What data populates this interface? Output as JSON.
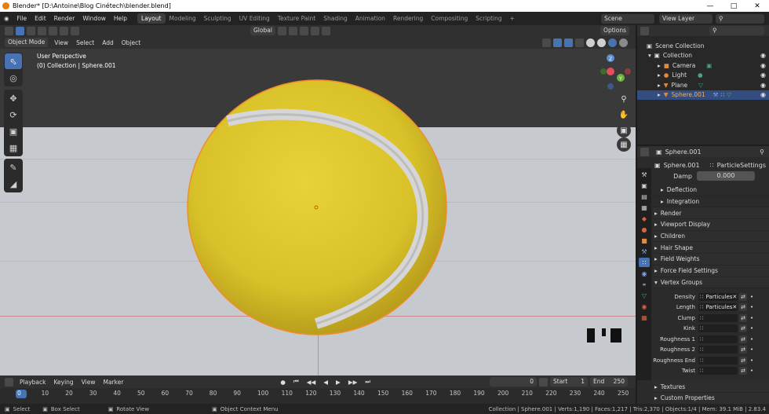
{
  "window": {
    "title": "Blender* [D:\\Antoine\\Blog Cinétech\\blender.blend]"
  },
  "menu": [
    "File",
    "Edit",
    "Render",
    "Window",
    "Help"
  ],
  "workspaces": [
    "Layout",
    "Modeling",
    "Sculpting",
    "UV Editing",
    "Texture Paint",
    "Shading",
    "Animation",
    "Rendering",
    "Compositing",
    "Scripting"
  ],
  "add_tab": "+",
  "scene": "Scene",
  "view_layer": "View Layer",
  "toolheader": {
    "orientation": "Global",
    "options": "Options"
  },
  "viewheader": {
    "mode": "Object Mode",
    "items": [
      "View",
      "Select",
      "Add",
      "Object"
    ]
  },
  "viewport": {
    "perspective": "User Perspective",
    "collection_info": "(0) Collection | Sphere.001"
  },
  "gizmo": {
    "z": "Z",
    "y": "Y",
    "x": "X"
  },
  "outliner": {
    "title": "Scene Collection",
    "rows": [
      {
        "label": "Collection",
        "icon": "collection-icon"
      },
      {
        "label": "Camera",
        "icon": "camera-icon"
      },
      {
        "label": "Light",
        "icon": "light-icon"
      },
      {
        "label": "Plane",
        "icon": "mesh-icon"
      },
      {
        "label": "Sphere.001",
        "icon": "mesh-icon"
      }
    ]
  },
  "properties": {
    "object": "Sphere.001",
    "object2": "Sphere.001",
    "system": "ParticleSettings",
    "damp_label": "Damp",
    "damp_value": "0.000",
    "sub_panels": [
      "Deflection",
      "Integration"
    ],
    "panels": [
      "Render",
      "Viewport Display",
      "Children",
      "Hair Shape",
      "Field Weights",
      "Force Field Settings"
    ],
    "vertex_groups_title": "Vertex Groups",
    "vertex_groups": [
      {
        "label": "Density",
        "value": "Particules"
      },
      {
        "label": "Length",
        "value": "Particules"
      },
      {
        "label": "Clump",
        "value": ""
      },
      {
        "label": "Kink",
        "value": ""
      },
      {
        "label": "Roughness 1",
        "value": ""
      },
      {
        "label": "Roughness 2",
        "value": ""
      },
      {
        "label": "Roughness End",
        "value": ""
      },
      {
        "label": "Twist",
        "value": ""
      }
    ],
    "bottom_panels": [
      "Textures",
      "Custom Properties"
    ]
  },
  "timeline": {
    "menu": [
      "Playback",
      "Keying",
      "View",
      "Marker"
    ],
    "current_frame": "0",
    "start_label": "Start",
    "start": "1",
    "end_label": "End",
    "end": "250",
    "ticks": [
      "0",
      "10",
      "20",
      "30",
      "40",
      "50",
      "60",
      "70",
      "80",
      "90",
      "100",
      "110",
      "120",
      "130",
      "140",
      "150",
      "160",
      "170",
      "180",
      "190",
      "200",
      "210",
      "220",
      "230",
      "240",
      "250"
    ]
  },
  "status": {
    "select": "Select",
    "box_select": "Box Select",
    "rotate": "Rotate View",
    "context_menu": "Object Context Menu",
    "stats": "Collection | Sphere.001 | Verts:1,190 | Faces:1,217 | Tris:2,370 | Objects:1/4 | Mem: 39.1 MiB | 2.83.4"
  },
  "colors": {
    "accent": "#4772b3",
    "ball": "#e3cc2c",
    "selection_outline": "#f28c28"
  }
}
